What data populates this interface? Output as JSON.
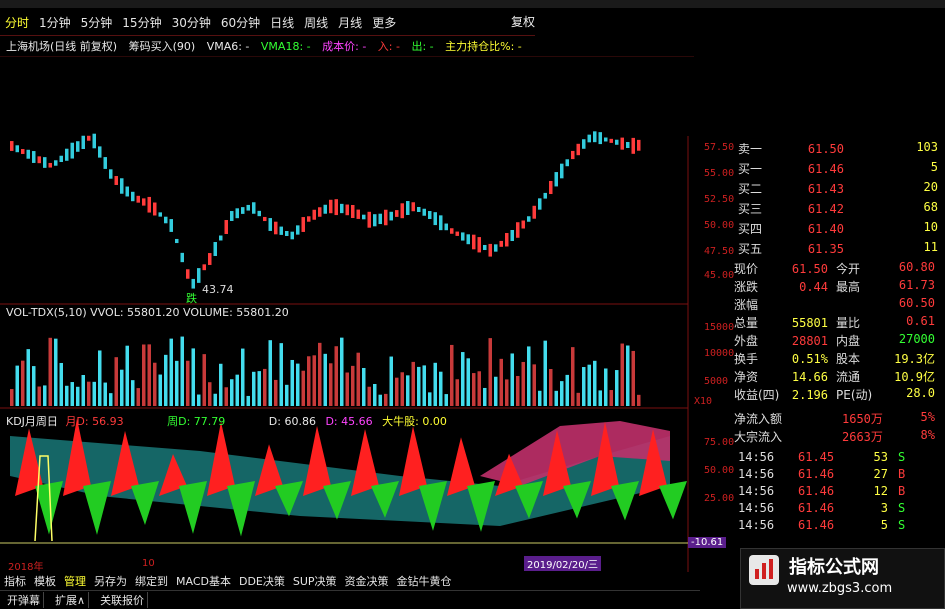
{
  "periods": [
    "分时",
    "1分钟",
    "5分钟",
    "15分钟",
    "30分钟",
    "60分钟",
    "日线",
    "周线",
    "月线",
    "更多"
  ],
  "active_period": "分时",
  "fuquan": "复权",
  "info": {
    "stock": "上海机场(日线 前复权)",
    "indicator": "筹码买入(90)",
    "vma6": "VMA6: -",
    "vma18": "VMA18: -",
    "cost": "成本价: -",
    "in_label": "入: -",
    "out_label": "出: -",
    "holding": "主力持仓比%: -"
  },
  "price_ticks": [
    "57.50",
    "55.00",
    "52.50",
    "50.00",
    "47.50",
    "45.00"
  ],
  "low_label": "43.74",
  "low_mark": "跌",
  "vol_header": "VOL-TDX(5,10) VVOL: 55801.20  VOLUME: 55801.20",
  "vol_ticks": [
    "15000",
    "10000",
    "5000",
    "X10"
  ],
  "kdj_header": {
    "name": "KDJ月周日",
    "d1": "月D: 56.93",
    "d2": "周D: 77.79",
    "d3": "D: 60.86",
    "d4": "D: 45.66",
    "buy": "大牛股: 0.00"
  },
  "kdj_ticks": [
    "75.00",
    "50.00",
    "25.00",
    "-10.61"
  ],
  "date_start": "2018年",
  "date_mid": "10",
  "date_cursor": "2019/02/20/三",
  "orderbook": [
    {
      "label": "卖一",
      "price": "61.50",
      "vol": "103"
    },
    {
      "label": "买一",
      "price": "61.46",
      "vol": "5"
    },
    {
      "label": "买二",
      "price": "61.43",
      "vol": "20"
    },
    {
      "label": "买三",
      "price": "61.42",
      "vol": "68"
    },
    {
      "label": "买四",
      "price": "61.40",
      "vol": "10"
    },
    {
      "label": "买五",
      "price": "61.35",
      "vol": "11"
    }
  ],
  "quote": [
    {
      "l1": "现价",
      "v1": "61.50",
      "c1": "#ff3b3b",
      "l2": "今开",
      "v2": "60.80",
      "c2": "#ff3b3b"
    },
    {
      "l1": "涨跌",
      "v1": "0.44",
      "c1": "#ff3b3b",
      "l2": "最高",
      "v2": "61.73",
      "c2": "#ff3b3b"
    },
    {
      "l1": "涨幅",
      "v1": "",
      "c1": "#ff3b3b",
      "l2": "",
      "v2": "60.50",
      "c2": "#ff3b3b"
    },
    {
      "l1": "总量",
      "v1": "55801",
      "c1": "#ffff44",
      "l2": "量比",
      "v2": "0.61",
      "c2": "#ff3b3b"
    },
    {
      "l1": "外盘",
      "v1": "28801",
      "c1": "#ff3b3b",
      "l2": "内盘",
      "v2": "27000",
      "c2": "#33ff33"
    },
    {
      "l1": "换手",
      "v1": "0.51%",
      "c1": "#ffff44",
      "l2": "股本",
      "v2": "19.3亿",
      "c2": "#ffff44"
    },
    {
      "l1": "净资",
      "v1": "14.66",
      "c1": "#ffff44",
      "l2": "流通",
      "v2": "10.9亿",
      "c2": "#ffff44"
    },
    {
      "l1": "收益(四)",
      "v1": "2.196",
      "c1": "#ffff44",
      "l2": "PE(动)",
      "v2": "28.0",
      "c2": "#ffff44"
    }
  ],
  "flows": [
    {
      "label": "净流入额",
      "value": "1650万",
      "pct": "5%"
    },
    {
      "label": "大宗流入",
      "value": "2663万",
      "pct": "8%"
    }
  ],
  "ticks": [
    {
      "time": "14:56",
      "price": "61.45",
      "vol": "53",
      "side": "S",
      "color": "#33ff33"
    },
    {
      "time": "14:56",
      "price": "61.46",
      "vol": "27",
      "side": "B",
      "color": "#ff3b3b"
    },
    {
      "time": "14:56",
      "price": "61.46",
      "vol": "12",
      "side": "B",
      "color": "#ff3b3b"
    },
    {
      "time": "14:56",
      "price": "61.46",
      "vol": "3",
      "side": "S",
      "color": "#33ff33"
    },
    {
      "time": "14:56",
      "price": "61.46",
      "vol": "5",
      "side": "S",
      "color": "#33ff33"
    }
  ],
  "bottom_tabs": [
    "指标",
    "模板",
    "管理",
    "另存为",
    "绑定到",
    "MACD基本",
    "DDE决策",
    "SUP决策",
    "资金决策",
    "金钻牛黄仓"
  ],
  "bottom_active": "管理",
  "bottom_tabs2": [
    "开弹幕",
    "扩展∧",
    "关联报价"
  ],
  "watermark_title": "指标公式网",
  "watermark_url": "www.zbgs3.com",
  "colors": {
    "up": "#ff3b3b",
    "down": "#33ccdd",
    "accent": "#ffff33",
    "border": "#7a1010"
  }
}
